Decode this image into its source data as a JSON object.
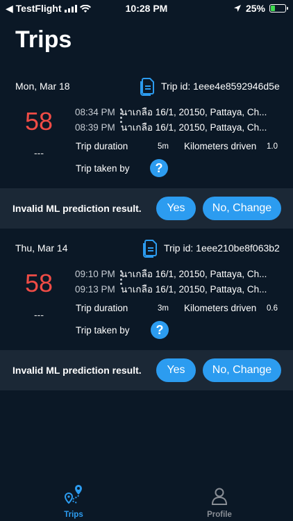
{
  "status_bar": {
    "carrier": "◀ TestFlight",
    "time": "10:28 PM",
    "battery": "25%"
  },
  "header": {
    "title": "Trips"
  },
  "trips": [
    {
      "date": "Mon, Mar 18",
      "trip_id_label": "Trip id: 1eee4e8592946d5e",
      "score": "58",
      "score_sub": "---",
      "start_time": "08:34 PM",
      "start_addr": "นาเกลือ 16/1, 20150, Pattaya, Ch...",
      "end_time": "08:39 PM",
      "end_addr": "นาเกลือ 16/1, 20150, Pattaya, Ch...",
      "duration_label": "Trip duration",
      "duration_value": "5m",
      "km_label": "Kilometers driven",
      "km_value": "1.0",
      "taken_by_label": "Trip taken by",
      "help_glyph": "?"
    },
    {
      "date": "Thu, Mar 14",
      "trip_id_label": "Trip id: 1eee210be8f063b2",
      "score": "58",
      "score_sub": "---",
      "start_time": "09:10 PM",
      "start_addr": "นาเกลือ 16/1, 20150, Pattaya, Ch...",
      "end_time": "09:13 PM",
      "end_addr": "นาเกลือ 16/1, 20150, Pattaya, Ch...",
      "duration_label": "Trip duration",
      "duration_value": "3m",
      "km_label": "Kilometers driven",
      "km_value": "0.6",
      "taken_by_label": "Trip taken by",
      "help_glyph": "?"
    }
  ],
  "prediction": {
    "text": "Invalid ML prediction result.",
    "yes_label": "Yes",
    "change_label": "No, Change"
  },
  "tabs": [
    {
      "label": "Trips",
      "active": true
    },
    {
      "label": "Profile",
      "active": false
    }
  ],
  "colors": {
    "background": "#0b1826",
    "accent": "#2c9cf0",
    "score": "#f04c46",
    "bar": "#1b2836",
    "inactive_tab": "#8a8f96"
  }
}
